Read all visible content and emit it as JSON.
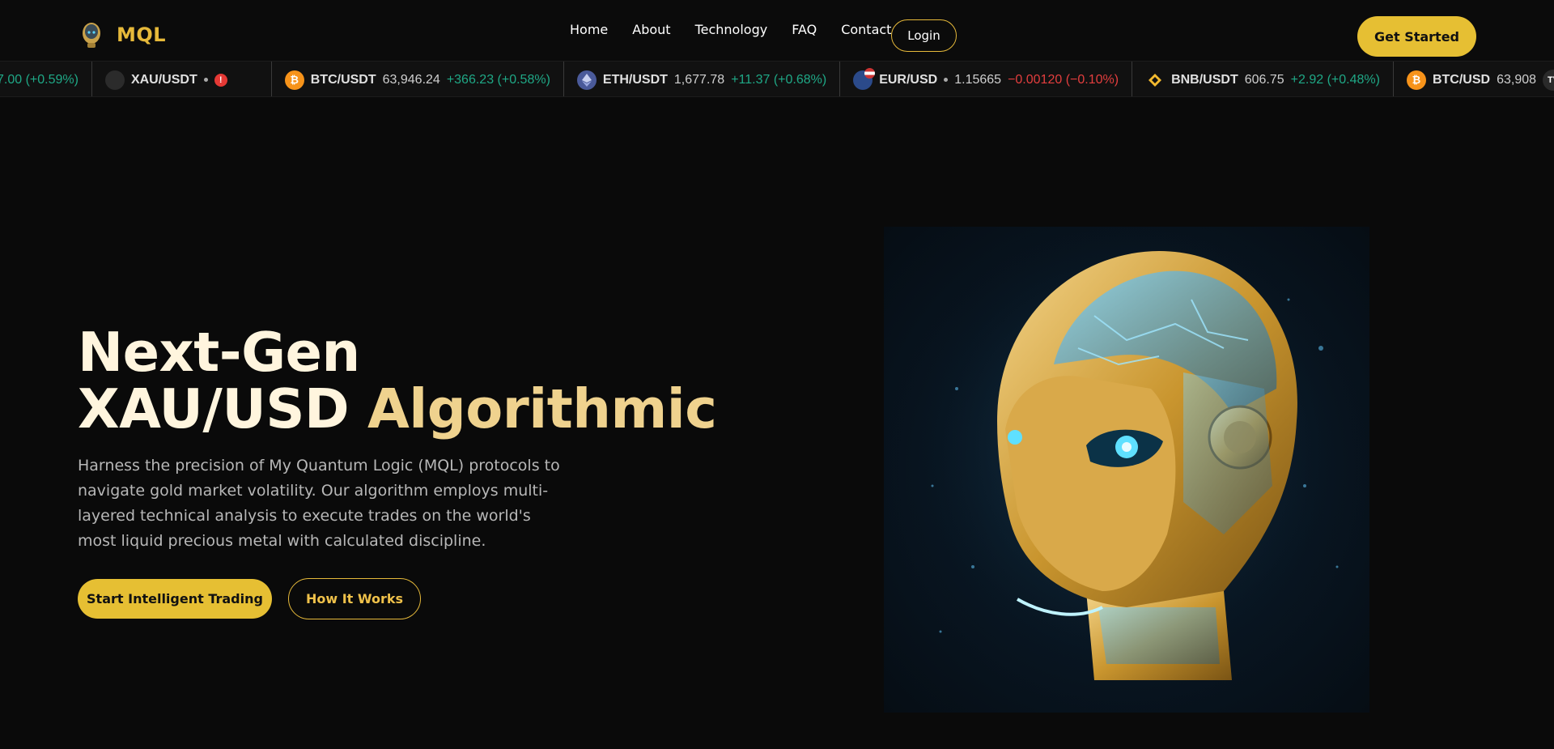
{
  "brand": {
    "name": "MQL"
  },
  "nav": {
    "items": [
      "Home",
      "About",
      "Technology",
      "FAQ",
      "Contact"
    ],
    "login_label": "Login",
    "get_started_label": "Get Started"
  },
  "ticker": {
    "items": [
      {
        "text": "7.00 (+0.59%)"
      },
      {
        "symbol": "XAU/USDT",
        "coin_icon": "gold-coin-icon"
      },
      {
        "symbol": "BTC/USDT",
        "price": "63,946.24",
        "change": "+366.23 (+0.58%)",
        "coin_icon": "bitcoin-icon",
        "coin_color": "#f7931a"
      },
      {
        "symbol": "ETH/USDT",
        "price": "1,677.78",
        "change": "+11.37 (+0.68%)",
        "coin_icon": "ethereum-icon",
        "coin_color": "#4a5a9a"
      },
      {
        "symbol": "EUR/USD",
        "price": "1.15665",
        "change": "−0.00120 (−0.10%)",
        "coin_icon": "eur-usd-flag-icon"
      },
      {
        "symbol": "BNB/USDT",
        "price": "606.75",
        "change": "+2.92 (+0.48%)",
        "coin_icon": "bnb-icon",
        "coin_color": "#f3ba2f"
      },
      {
        "symbol": "BTC/USD",
        "price": "63,908",
        "coin_icon": "bitcoin-icon",
        "coin_color": "#f7931a"
      }
    ]
  },
  "hero": {
    "title_line1": "Next-Gen",
    "title_line2_a": "XAU/USD",
    "title_line2_b": "Algorithmic",
    "description": "Harness the precision of My Quantum Logic (MQL) protocols to navigate gold market volatility. Our algorithm employs multi-layered technical analysis to execute trades on the world's most liquid precious metal with calculated discipline.",
    "primary_cta": "Start Intelligent Trading",
    "secondary_cta": "How It Works"
  },
  "colors": {
    "accent": "#e6bf33",
    "positive": "#1fa886",
    "negative": "#e33e3e"
  }
}
